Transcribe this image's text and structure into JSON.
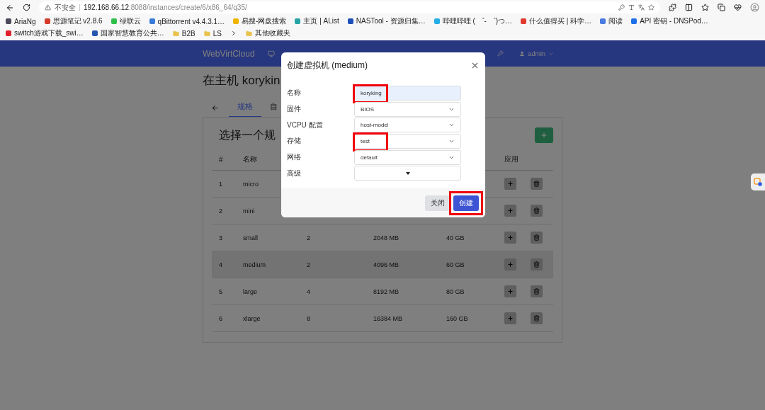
{
  "browser": {
    "security_label": "不安全",
    "url_host": "192.168.66.12",
    "url_rest": ":8088/instances/create/6/x86_64/q35/"
  },
  "bookmarks": [
    {
      "kind": "site",
      "label": "AriaNg",
      "color": "#4a4a5a"
    },
    {
      "kind": "site",
      "label": "思源笔记 v2.8.6",
      "color": "#d23a2a"
    },
    {
      "kind": "site",
      "label": "绿联云",
      "color": "#2fbf4a"
    },
    {
      "kind": "site",
      "label": "qBittorrent v4.4.3.1…",
      "color": "#3a7bd5"
    },
    {
      "kind": "site",
      "label": "易搜-网盘搜索",
      "color": "#f0b400"
    },
    {
      "kind": "site",
      "label": "主页 | AList",
      "color": "#27a3a3"
    },
    {
      "kind": "site",
      "label": "NASTool - 资源归集…",
      "color": "#1d4fb8"
    },
    {
      "kind": "site",
      "label": "哔哩哔哩 ( ゜- ゜)つ…",
      "color": "#23ade5"
    },
    {
      "kind": "site",
      "label": "什么值得买 | 科学…",
      "color": "#e03a2f"
    },
    {
      "kind": "site",
      "label": "阅读",
      "color": "#4a7be0"
    },
    {
      "kind": "site",
      "label": "API 密钥 - DNSPod…",
      "color": "#1e6fe8"
    },
    {
      "kind": "site",
      "label": "switch游戏下载_swi…",
      "color": "#e0202a"
    },
    {
      "kind": "site",
      "label": "国家智慧教育公共…",
      "color": "#2456b0"
    },
    {
      "kind": "folder",
      "label": "B2B",
      "color": "#e8c24a"
    },
    {
      "kind": "folder",
      "label": "LS",
      "color": "#e8c24a"
    },
    {
      "kind": "folder",
      "label": "其他收藏夹",
      "color": "#e8c24a"
    }
  ],
  "navbar": {
    "brand": "WebVirtCloud",
    "user": "admin"
  },
  "page": {
    "title": "在主机 korykin",
    "tabs": [
      {
        "label": "规格",
        "selected": true
      },
      {
        "label": "自",
        "selected": false
      }
    ],
    "heading": "选择一个规"
  },
  "table": {
    "columns": [
      "#",
      "名称",
      "应用"
    ],
    "rows": [
      {
        "id": "1",
        "name": "micro",
        "highlighted": false
      },
      {
        "id": "2",
        "name": "mini",
        "highlighted": false
      },
      {
        "id": "3",
        "name": "small",
        "vcpu": "2",
        "memory": "2048 MB",
        "disk": "40 GB",
        "highlighted": false
      },
      {
        "id": "4",
        "name": "medium",
        "vcpu": "2",
        "memory": "4096 MB",
        "disk": "60 GB",
        "highlighted": true
      },
      {
        "id": "5",
        "name": "large",
        "vcpu": "4",
        "memory": "8192 MB",
        "disk": "80 GB",
        "highlighted": false
      },
      {
        "id": "6",
        "name": "xlarge",
        "vcpu": "8",
        "memory": "16384 MB",
        "disk": "160 GB",
        "highlighted": false
      }
    ]
  },
  "modal": {
    "title": "创建虚拟机 (medium)",
    "fields": [
      {
        "kind": "input",
        "label": "名称",
        "value": "koryking",
        "marked": true
      },
      {
        "kind": "select",
        "label": "固件",
        "value": "BIOS",
        "marked": false
      },
      {
        "kind": "select",
        "label": "VCPU 配置",
        "value": "host-model",
        "marked": false
      },
      {
        "kind": "select",
        "label": "存储",
        "value": "test",
        "marked": true
      },
      {
        "kind": "select",
        "label": "网络",
        "value": "default",
        "marked": false
      },
      {
        "kind": "dropdown",
        "label": "高级",
        "marked": false
      }
    ],
    "buttons": [
      {
        "kind": "secondary",
        "label": "关闭",
        "marked": false
      },
      {
        "kind": "primary",
        "label": "创建",
        "marked": true
      }
    ]
  }
}
